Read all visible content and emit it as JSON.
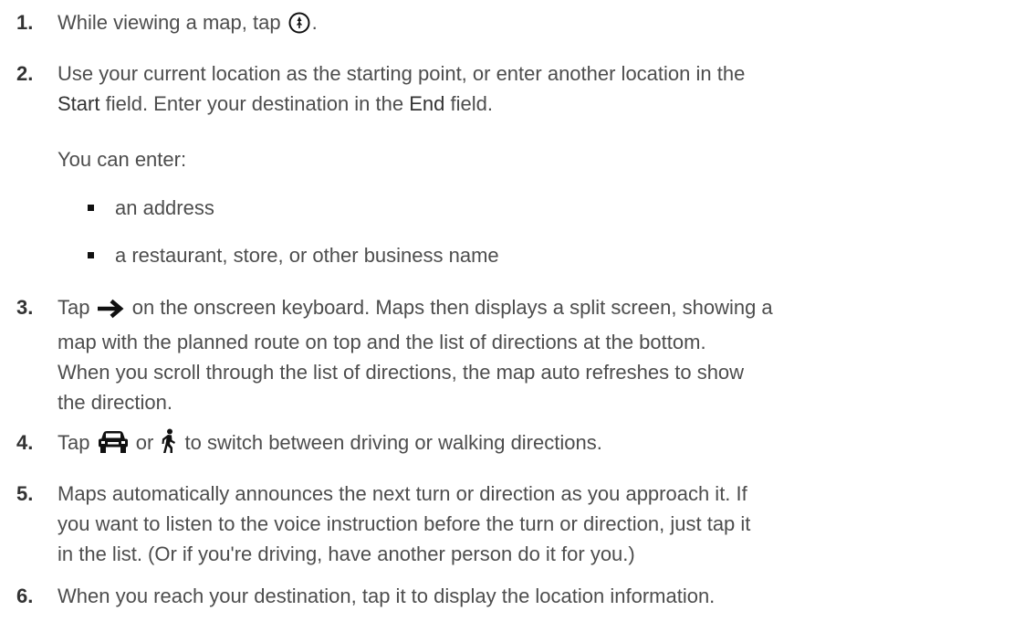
{
  "steps": [
    {
      "num": "1.",
      "pre": "While viewing a map, tap ",
      "icon": "directions-compass-icon",
      "post": "."
    },
    {
      "num": "2.",
      "l1": "Use your current location as the starting point, or enter another location in the",
      "start": "Start",
      "mid": " field. Enter your destination in the ",
      "end": "End",
      "post": " field."
    },
    {
      "num": "3.",
      "pre": "Tap ",
      "icon": "arrow-right-icon",
      "post": " on the onscreen keyboard. Maps then displays a split screen, showing a",
      "l2": "map with the planned route on top and the list of directions at the bottom.",
      "l3": "When you scroll through the list of directions, the map auto refreshes to show",
      "l4": "the direction."
    },
    {
      "num": "4.",
      "pre": "Tap ",
      "icon1": "car-icon",
      "mid": " or ",
      "icon2": "walking-person-icon",
      "post": " to switch between driving or walking directions."
    },
    {
      "num": "5.",
      "l1": "Maps automatically announces the next turn or direction as you approach it. If",
      "l2": "you want to listen to the voice instruction before the turn or direction, just tap it",
      "l3": "in the list. (Or if you're driving, have another person do it for you.)"
    },
    {
      "num": "6.",
      "l1": "When you reach your destination, tap it to display the location information."
    }
  ],
  "sub_intro": "You can enter:",
  "bullets": [
    "an address",
    "a restaurant, store, or other business name"
  ],
  "colors": {
    "text": "#4d4d4d",
    "number": "#333333",
    "icon": "#111111"
  }
}
